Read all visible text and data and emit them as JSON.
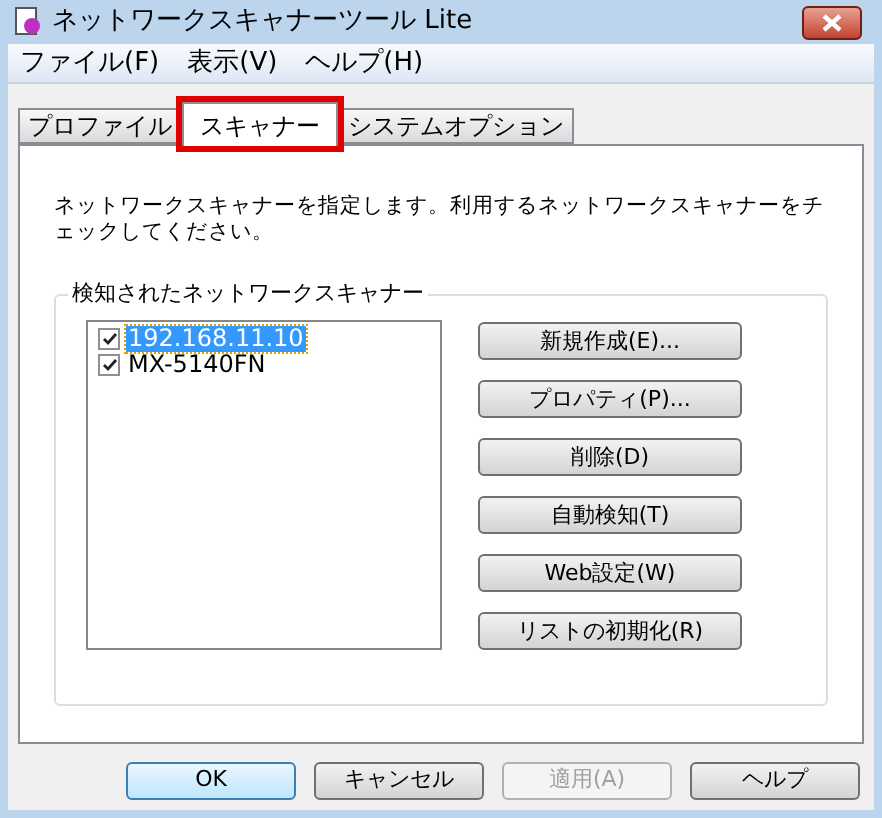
{
  "window": {
    "title": "ネットワークスキャナーツール Lite"
  },
  "menu": [
    "ファイル(F)",
    "表示(V)",
    "ヘルプ(H)"
  ],
  "tabs": [
    {
      "label": "プロファイル",
      "selected": false,
      "highlighted": false
    },
    {
      "label": "スキャナー",
      "selected": true,
      "highlighted": true
    },
    {
      "label": "システムオプション",
      "selected": false,
      "highlighted": false
    }
  ],
  "description": "ネットワークスキャナーを指定します。利用するネットワークスキャナーをチェックしてください。",
  "scanners": {
    "title": "検知されたネットワークスキャナー",
    "items": [
      {
        "name": "192.168.11.10",
        "checked": true,
        "selected": true
      },
      {
        "name": "MX-5140FN",
        "checked": true,
        "selected": false
      }
    ]
  },
  "actions": [
    "新規作成(E)...",
    "プロパティ(P)...",
    "削除(D)",
    "自動検知(T)",
    "Web設定(W)",
    "リストの初期化(R)"
  ],
  "buttons": [
    {
      "label": "OK",
      "default": true,
      "disabled": false
    },
    {
      "label": "キャンセル",
      "default": false,
      "disabled": false
    },
    {
      "label": "適用(A)",
      "default": false,
      "disabled": true
    },
    {
      "label": "ヘルプ",
      "default": false,
      "disabled": false
    }
  ]
}
